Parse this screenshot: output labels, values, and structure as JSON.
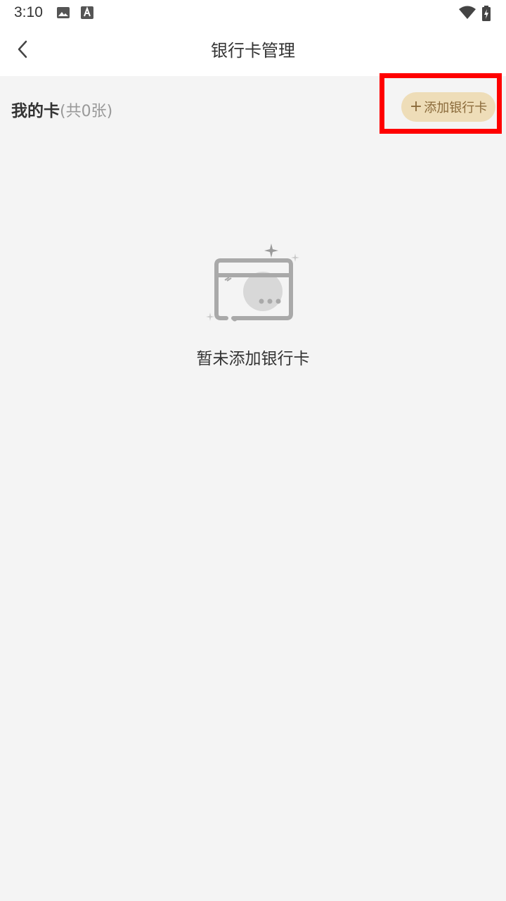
{
  "status_bar": {
    "time": "3:10",
    "icons": [
      "image-icon",
      "font-icon",
      "wifi-icon",
      "battery-charging-icon"
    ]
  },
  "nav": {
    "title": "银行卡管理",
    "back_icon": "chevron-left-icon"
  },
  "section": {
    "title": "我的卡",
    "count_text": "(共0张)"
  },
  "add_button": {
    "plus": "+",
    "label": "添加银行卡"
  },
  "empty_state": {
    "icon": "empty-card-icon",
    "message": "暂未添加银行卡"
  },
  "colors": {
    "highlight": "#ff0000",
    "button_bg": "#eeddb8",
    "button_text": "#8a6a3a",
    "background": "#f4f4f4"
  }
}
